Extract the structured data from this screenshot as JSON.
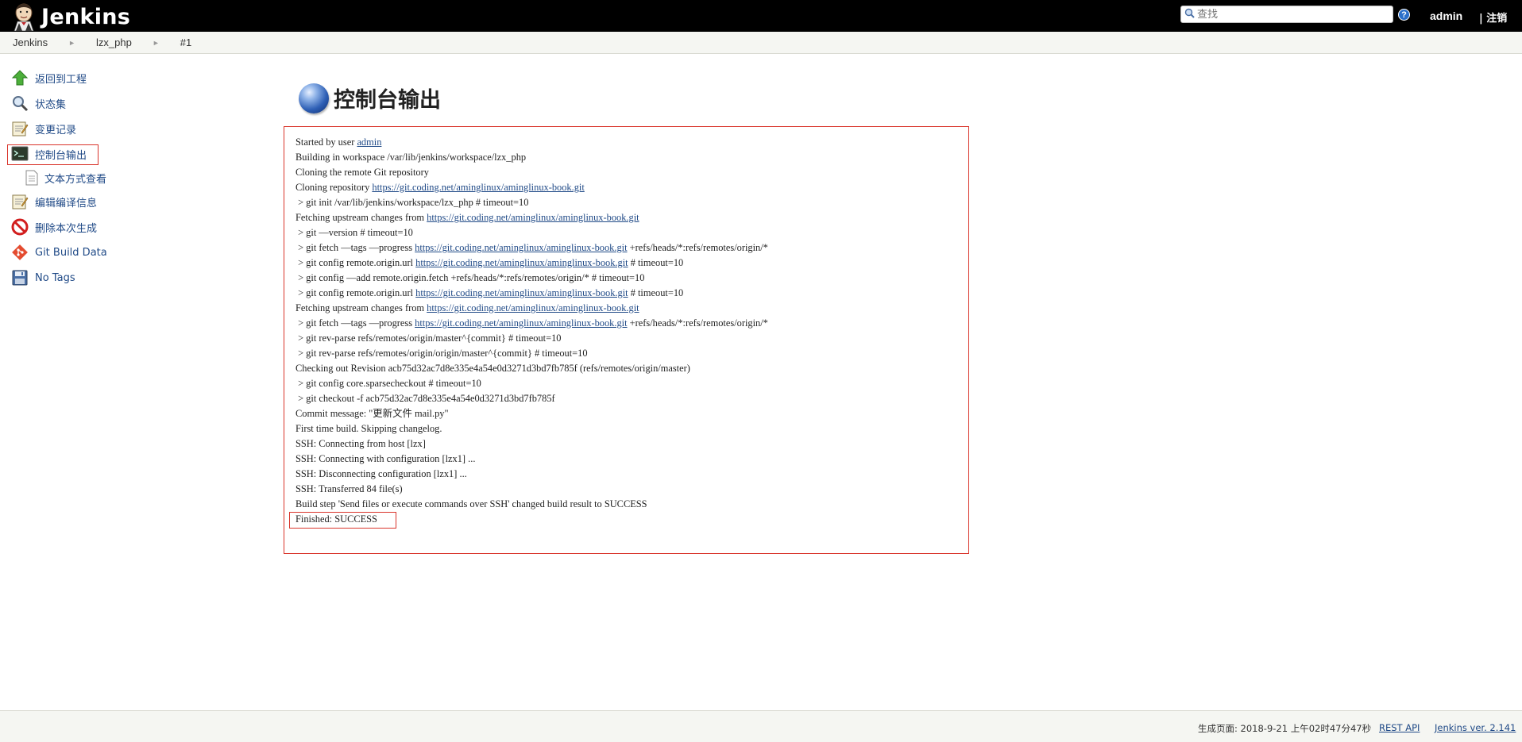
{
  "header": {
    "app_title": "Jenkins",
    "search_placeholder": "查找",
    "help_glyph": "?",
    "user": "admin",
    "logout": "| 注销"
  },
  "breadcrumbs": [
    {
      "label": "Jenkins"
    },
    {
      "label": "lzx_php"
    },
    {
      "label": "#1"
    }
  ],
  "sidebar": {
    "items": [
      {
        "label": "返回到工程",
        "icon": "up-arrow-icon"
      },
      {
        "label": "状态集",
        "icon": "magnifier-icon"
      },
      {
        "label": "变更记录",
        "icon": "notepad-icon"
      },
      {
        "label": "控制台输出",
        "icon": "terminal-icon",
        "active": true
      },
      {
        "label": "文本方式查看",
        "icon": "document-icon",
        "sub": true
      },
      {
        "label": "编辑编译信息",
        "icon": "notepad-icon"
      },
      {
        "label": "删除本次生成",
        "icon": "no-entry-icon"
      },
      {
        "label": "Git Build Data",
        "icon": "git-icon"
      },
      {
        "label": "No Tags",
        "icon": "save-disk-icon"
      }
    ]
  },
  "main": {
    "title": "控制台输出",
    "console_lines": [
      {
        "pre": "Started by user ",
        "link": "admin",
        "post": ""
      },
      {
        "pre": "Building in workspace /var/lib/jenkins/workspace/lzx_php",
        "link": "",
        "post": ""
      },
      {
        "pre": "Cloning the remote Git repository",
        "link": "",
        "post": ""
      },
      {
        "pre": "Cloning repository ",
        "link": "https://git.coding.net/aminglinux/aminglinux-book.git",
        "post": ""
      },
      {
        "pre": " > git init /var/lib/jenkins/workspace/lzx_php # timeout=10",
        "link": "",
        "post": ""
      },
      {
        "pre": "Fetching upstream changes from ",
        "link": "https://git.coding.net/aminglinux/aminglinux-book.git",
        "post": ""
      },
      {
        "pre": " > git —version # timeout=10",
        "link": "",
        "post": ""
      },
      {
        "pre": " > git fetch —tags —progress ",
        "link": "https://git.coding.net/aminglinux/aminglinux-book.git",
        "post": " +refs/heads/*:refs/remotes/origin/*"
      },
      {
        "pre": " > git config remote.origin.url ",
        "link": "https://git.coding.net/aminglinux/aminglinux-book.git",
        "post": " # timeout=10"
      },
      {
        "pre": " > git config —add remote.origin.fetch +refs/heads/*:refs/remotes/origin/* # timeout=10",
        "link": "",
        "post": ""
      },
      {
        "pre": " > git config remote.origin.url ",
        "link": "https://git.coding.net/aminglinux/aminglinux-book.git",
        "post": " # timeout=10"
      },
      {
        "pre": "Fetching upstream changes from ",
        "link": "https://git.coding.net/aminglinux/aminglinux-book.git",
        "post": ""
      },
      {
        "pre": " > git fetch —tags —progress ",
        "link": "https://git.coding.net/aminglinux/aminglinux-book.git",
        "post": " +refs/heads/*:refs/remotes/origin/*"
      },
      {
        "pre": " > git rev-parse refs/remotes/origin/master^{commit} # timeout=10",
        "link": "",
        "post": ""
      },
      {
        "pre": " > git rev-parse refs/remotes/origin/origin/master^{commit} # timeout=10",
        "link": "",
        "post": ""
      },
      {
        "pre": "Checking out Revision acb75d32ac7d8e335e4a54e0d3271d3bd7fb785f (refs/remotes/origin/master)",
        "link": "",
        "post": ""
      },
      {
        "pre": " > git config core.sparsecheckout # timeout=10",
        "link": "",
        "post": ""
      },
      {
        "pre": " > git checkout -f acb75d32ac7d8e335e4a54e0d3271d3bd7fb785f",
        "link": "",
        "post": ""
      },
      {
        "pre": "Commit message: \"更新文件 mail.py\"",
        "link": "",
        "post": ""
      },
      {
        "pre": "First time build. Skipping changelog.",
        "link": "",
        "post": ""
      },
      {
        "pre": "SSH: Connecting from host [lzx]",
        "link": "",
        "post": ""
      },
      {
        "pre": "SSH: Connecting with configuration [lzx1] ...",
        "link": "",
        "post": ""
      },
      {
        "pre": "SSH: Disconnecting configuration [lzx1] ...",
        "link": "",
        "post": ""
      },
      {
        "pre": "SSH: Transferred 84 file(s)",
        "link": "",
        "post": ""
      },
      {
        "pre": "Build step 'Send files or execute commands over SSH' changed build result to SUCCESS",
        "link": "",
        "post": ""
      },
      {
        "pre": "Finished: SUCCESS",
        "link": "",
        "post": ""
      }
    ]
  },
  "footer": {
    "generated": "生成页面: 2018-9-21 上午02时47分47秒",
    "rest_api": "REST API",
    "version": "Jenkins ver. 2.141"
  },
  "colors": {
    "header_bg": "#000000",
    "link": "#204a87",
    "highlight_border": "#d9342b"
  }
}
